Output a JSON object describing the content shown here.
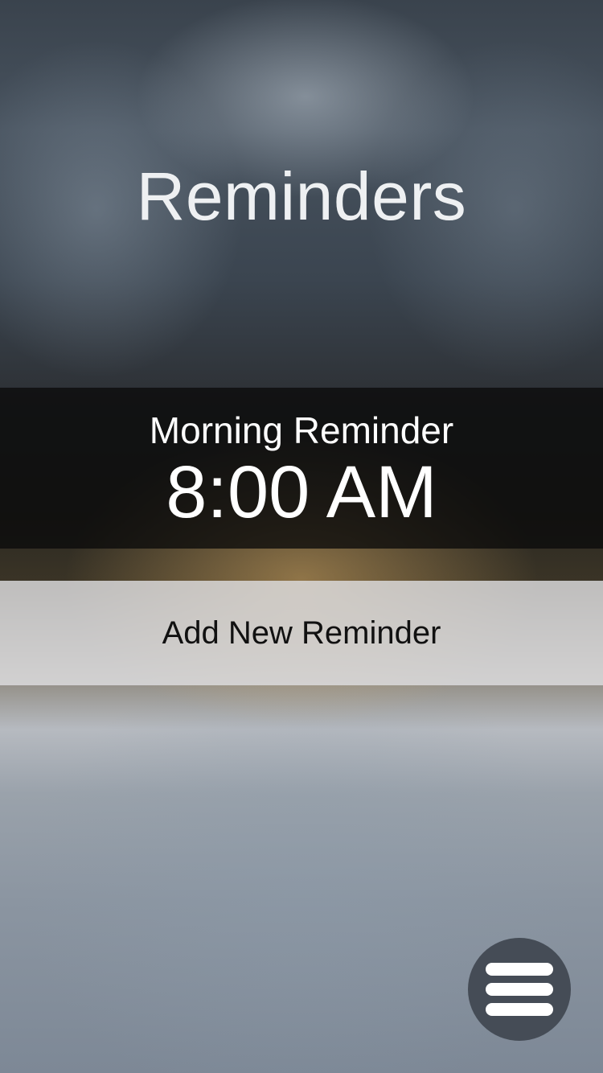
{
  "header": {
    "title": "Reminders"
  },
  "reminders": [
    {
      "name": "Morning Reminder",
      "time": "8:00 AM"
    }
  ],
  "actions": {
    "add_label": "Add New Reminder",
    "menu_icon": "hamburger-menu-icon"
  },
  "colors": {
    "card_background": "#0a0a0a",
    "add_button_background": "#dedee0",
    "menu_button_background": "#454c56"
  }
}
